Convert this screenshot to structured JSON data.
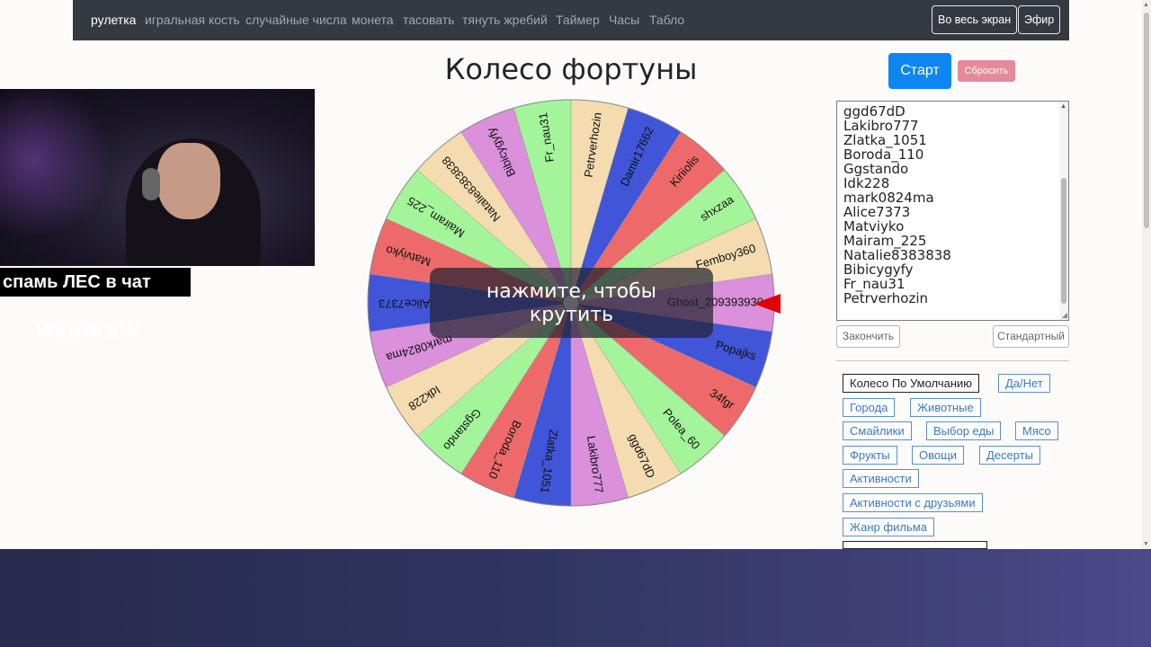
{
  "nav": {
    "items": [
      "рулетка",
      "игральная кость",
      "случайные числа",
      "монета",
      "тасовать",
      "тянуть жребий",
      "Таймер",
      "Часы",
      "Табло"
    ],
    "fullscreen_label": "Во весь экран",
    "live_label": "Эфир"
  },
  "page_title": "Колесо фортуны",
  "controls": {
    "start_label": "Старт",
    "reset_label": "Сбросить"
  },
  "stream": {
    "caption": "спамь ЛЕС в чат",
    "faded_text": "WEBHOOK"
  },
  "wheel": {
    "overlay_line1": "нажмите, чтобы",
    "overlay_line2": "крутить",
    "segments": [
      {
        "label": "Ghost_209393930",
        "color": "#da90da"
      },
      {
        "label": "Popajks",
        "color": "#4055d8"
      },
      {
        "label": "34fgr",
        "color": "#ee6a6a"
      },
      {
        "label": "Polea_60",
        "color": "#a4f59a"
      },
      {
        "label": "ggd67dD",
        "color": "#f4dcb0"
      },
      {
        "label": "Lakibro777",
        "color": "#da90da"
      },
      {
        "label": "Zlatka_1051",
        "color": "#4055d8"
      },
      {
        "label": "Boroda_110",
        "color": "#ee6a6a"
      },
      {
        "label": "Ggstando",
        "color": "#a4f59a"
      },
      {
        "label": "Idk228",
        "color": "#f4dcb0"
      },
      {
        "label": "mark0824ma",
        "color": "#da90da"
      },
      {
        "label": "Alice7373",
        "color": "#4055d8"
      },
      {
        "label": "Matviyko",
        "color": "#ee6a6a"
      },
      {
        "label": "Mairam_225",
        "color": "#a4f59a"
      },
      {
        "label": "Natalie8383838",
        "color": "#f4dcb0"
      },
      {
        "label": "Bibicygyfy",
        "color": "#da90da"
      },
      {
        "label": "Fr_nau31",
        "color": "#a4f59a"
      },
      {
        "label": "Petrverhozin",
        "color": "#f4dcb0"
      },
      {
        "label": "Damir17662",
        "color": "#4055d8"
      },
      {
        "label": "Kiriiolis",
        "color": "#ee6a6a"
      },
      {
        "label": "shxzaa",
        "color": "#a4f59a"
      },
      {
        "label": "Femboy360",
        "color": "#f4dcb0"
      }
    ]
  },
  "names_list": [
    "ggd67dD",
    "Lakibro777",
    "Zlatka_1051",
    "Boroda_110",
    "Ggstando",
    "Idk228",
    "mark0824ma",
    "Alice7373",
    "Matviyko",
    "Mairam_225",
    "Natalie8383838",
    "Bibicygyfy",
    "Fr_nau31",
    "Petrverhozin"
  ],
  "list_buttons": {
    "finish_label": "Закончить",
    "standard_label": "Стандартный"
  },
  "presets": [
    "Колесо По Умолчанию",
    "Да/Нет",
    "Города",
    "Животные",
    "Смайлики",
    "Выбор еды",
    "Мясо",
    "Фрукты",
    "Овощи",
    "Десерты",
    "Активности",
    "Активности с друзьями",
    "Жанр фильма"
  ]
}
